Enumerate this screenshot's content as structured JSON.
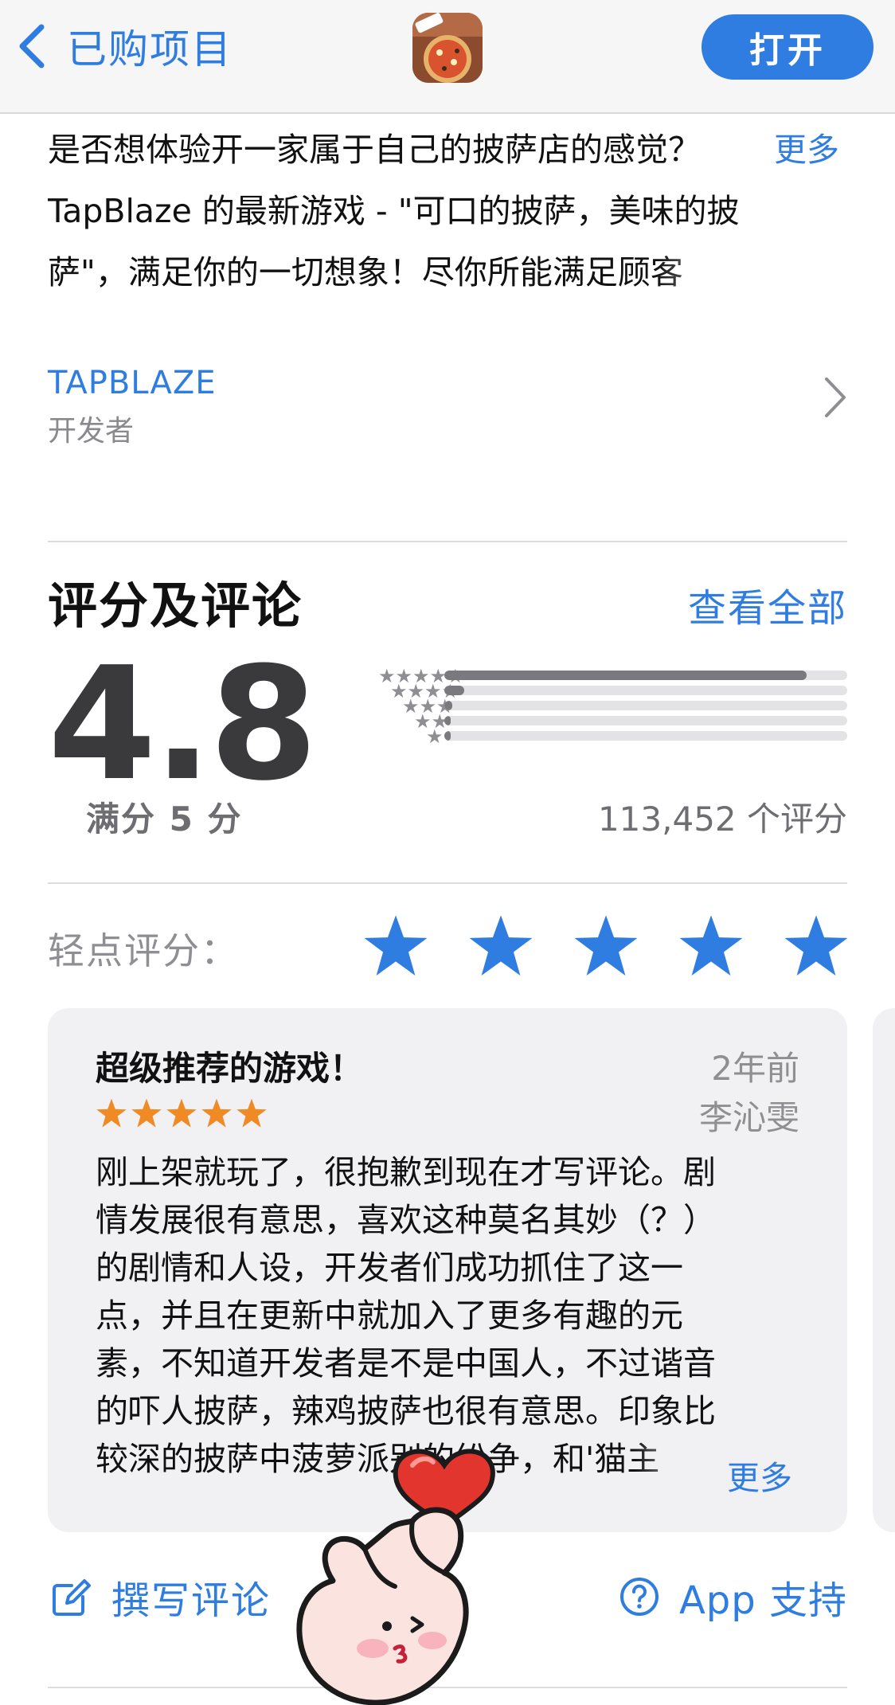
{
  "nav": {
    "back_label": "已购项目",
    "open_label": "打开",
    "app_icon": "pizza-app-icon"
  },
  "description": {
    "lines": [
      "是否想体验开一家属于自己的披萨店的感觉？",
      "TapBlaze 的最新游戏 - \"可口的披萨，美味的披",
      "萨\"，满足你的一切想象！尽你所能满足顾客"
    ],
    "more_label": "更多"
  },
  "developer": {
    "name": "TAPBLAZE",
    "role": "开发者"
  },
  "ratings": {
    "title": "评分及评论",
    "see_all": "查看全部",
    "score": "4.8",
    "out_of": "满分 5 分",
    "count": "113,452 个评分",
    "histogram": [
      {
        "stars": "★★★★★",
        "fraction": 0.9
      },
      {
        "stars": "★★★★",
        "fraction": 0.05
      },
      {
        "stars": "★★★",
        "fraction": 0.02
      },
      {
        "stars": "★★",
        "fraction": 0.01
      },
      {
        "stars": "★",
        "fraction": 0.015
      }
    ]
  },
  "tap_to_rate": {
    "label": "轻点评分：",
    "star_count": 5
  },
  "review": {
    "title": "超级推荐的游戏！",
    "date": "2年前",
    "author": "李沁雯",
    "stars": 5,
    "body_lines": [
      "刚上架就玩了，很抱歉到现在才写评论。剧",
      "情发展很有意思，喜欢这种莫名其妙（？）",
      "的剧情和人设，开发者们成功抓住了这一",
      "点，并且在更新中就加入了更多有趣的元",
      "素，不知道开发者是不是中国人，不过谐音",
      "的吓人披萨，辣鸡披萨也很有意思。印象比",
      "较深的披萨中菠萝派别的纷争，和'猫主"
    ],
    "more_label": "更多"
  },
  "actions": {
    "write_review": "撰写评论",
    "app_support": "App 支持"
  },
  "colors": {
    "accent": "#2f7de1",
    "review_star": "#f08a24",
    "histogram_fill": "#7a7a7e"
  }
}
